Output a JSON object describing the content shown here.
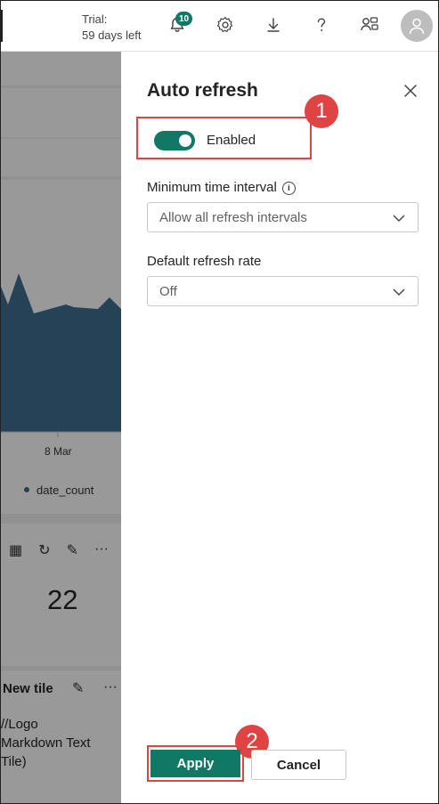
{
  "topbar": {
    "trial_line1": "Trial:",
    "trial_line2": "59 days left",
    "notification_count": "10",
    "icons": [
      "bell-icon",
      "gear-icon",
      "download-icon",
      "help-icon",
      "share-icon",
      "avatar-icon"
    ]
  },
  "background": {
    "chart_axis_label": "8 Mar",
    "legend_label": "date_count",
    "tile_value": "22",
    "tile_title": "New tile",
    "tile_text_line1": "//Logo",
    "tile_text_line2": "Markdown Text",
    "tile_text_line3": "Tile)",
    "series_color": "#3e6e92"
  },
  "panel": {
    "title": "Auto refresh",
    "toggle_label": "Enabled",
    "toggle_on": true,
    "min_interval_label": "Minimum time interval",
    "min_interval_value": "Allow all refresh intervals",
    "default_rate_label": "Default refresh rate",
    "default_rate_value": "Off",
    "apply_label": "Apply",
    "cancel_label": "Cancel"
  },
  "annotations": {
    "step1": "1",
    "step2": "2",
    "color": "#e04343"
  },
  "colors": {
    "accent": "#117865"
  }
}
